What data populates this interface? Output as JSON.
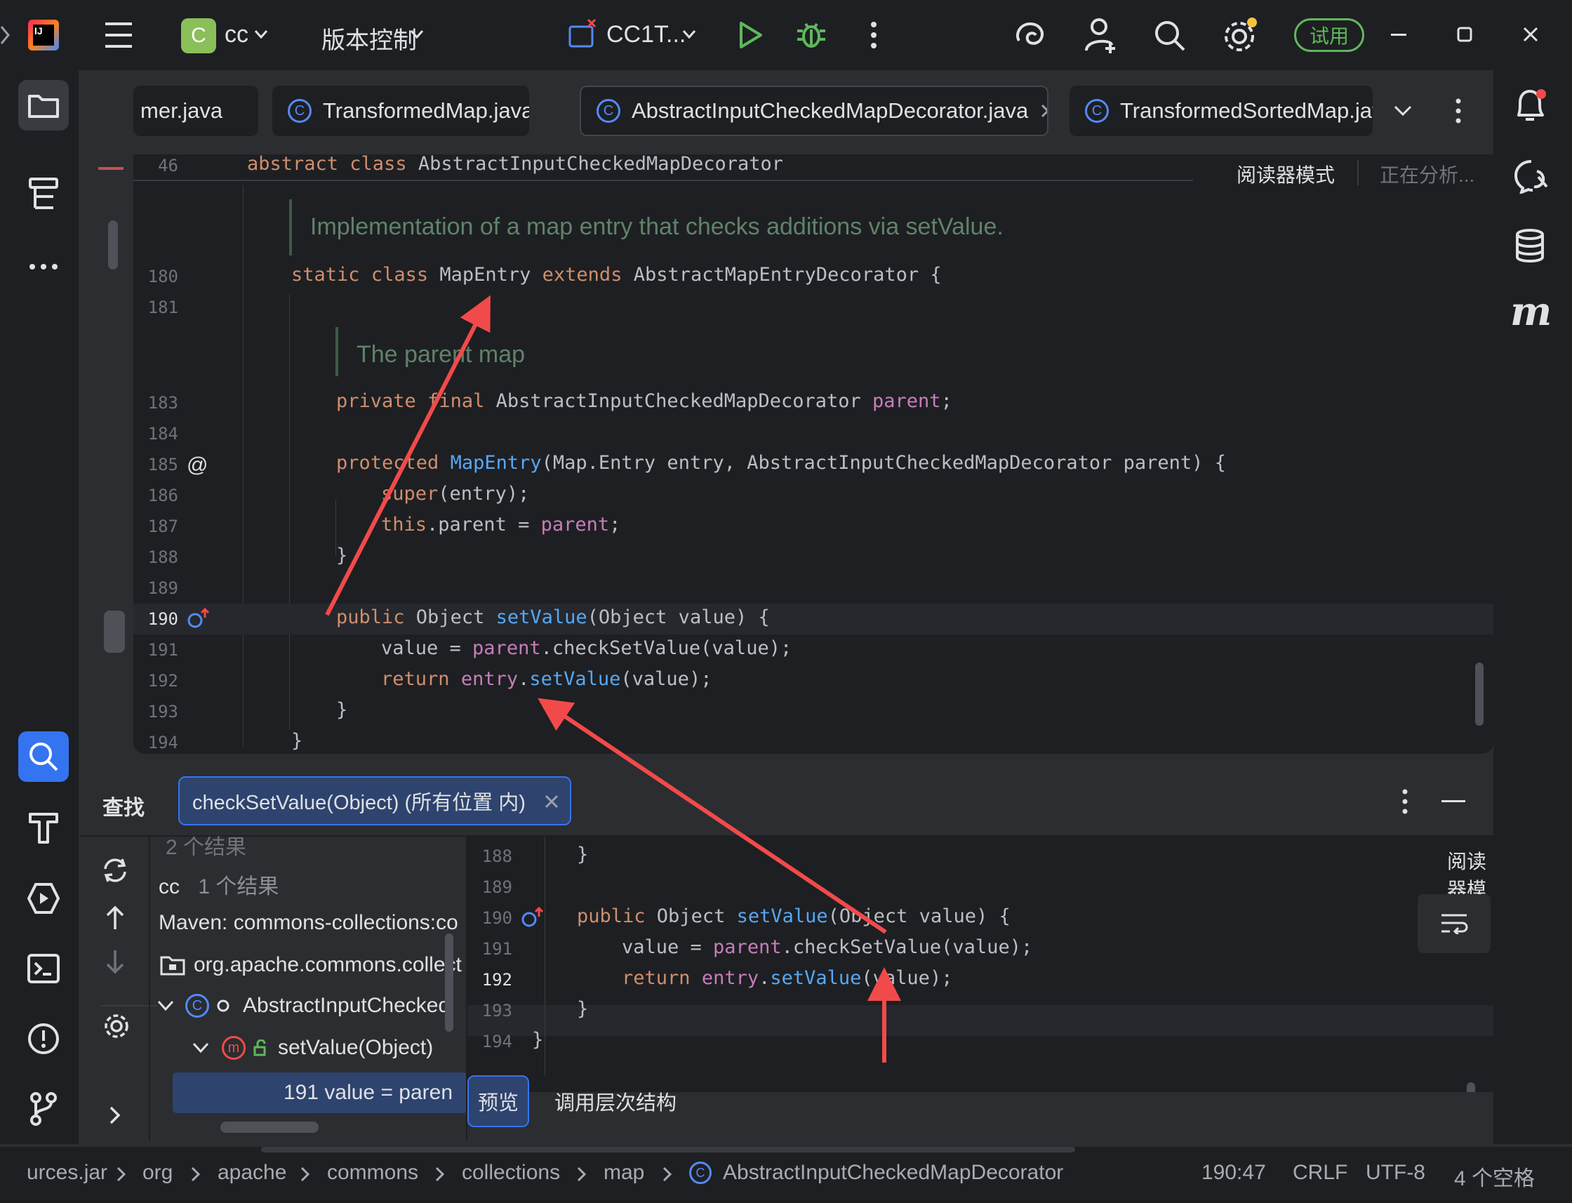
{
  "titlebar": {
    "project_letter": "C",
    "project_name": "cc",
    "vcs_label": "版本控制",
    "run_config": "CC1T...",
    "trial_label": "试用"
  },
  "tabs": [
    {
      "label": "mer.java"
    },
    {
      "label": "TransformedMap.java"
    },
    {
      "label": "AbstractInputCheckedMapDecorator.java",
      "active": true
    },
    {
      "label": "TransformedSortedMap.jav"
    }
  ],
  "editor": {
    "sticky_line_number": "46",
    "sticky_header": "abstract class AbstractInputCheckedMapDecorator",
    "reader_mode": "阅读器模式",
    "analyzing": "正在分析...",
    "doc_comment_1": "Implementation of a map entry that checks additions via setValue.",
    "doc_comment_2": "The parent map",
    "lines": [
      {
        "n": "180",
        "text": "static class MapEntry extends AbstractMapEntryDecorator {"
      },
      {
        "n": "181",
        "text": ""
      },
      {
        "n": "183",
        "text": "private final AbstractInputCheckedMapDecorator parent;"
      },
      {
        "n": "184",
        "text": ""
      },
      {
        "n": "185",
        "text": "protected MapEntry(Map.Entry entry, AbstractInputCheckedMapDecorator parent) {"
      },
      {
        "n": "186",
        "text": "super(entry);"
      },
      {
        "n": "187",
        "text": "this.parent = parent;"
      },
      {
        "n": "188",
        "text": "}"
      },
      {
        "n": "189",
        "text": ""
      },
      {
        "n": "190",
        "text": "public Object setValue(Object value) {"
      },
      {
        "n": "191",
        "text": "value = parent.checkSetValue(value);"
      },
      {
        "n": "192",
        "text": "return entry.setValue(value);"
      },
      {
        "n": "193",
        "text": "}"
      },
      {
        "n": "194",
        "text": "}"
      }
    ]
  },
  "find_panel": {
    "title": "查找",
    "query_tab": "checkSetValue(Object) (所有位置 内)",
    "results_total": "2 个结果",
    "tree": [
      {
        "label": "cc",
        "count": "1 个结果"
      },
      {
        "label": "Maven: commons-collections:co"
      },
      {
        "label": "org.apache.commons.collect"
      },
      {
        "label": "AbstractInputChecked"
      },
      {
        "label": "setValue(Object)"
      },
      {
        "label": "191 value = paren"
      }
    ],
    "preview_reader_mode": "阅读器模式",
    "preview_lines": [
      {
        "n": "188",
        "text": "}"
      },
      {
        "n": "189",
        "text": ""
      },
      {
        "n": "190",
        "text": "public Object setValue(Object value) {"
      },
      {
        "n": "191",
        "text": "value = parent.checkSetValue(value);"
      },
      {
        "n": "192",
        "text": "return entry.setValue(value);"
      },
      {
        "n": "193",
        "text": "}"
      },
      {
        "n": "194",
        "text": "}"
      }
    ],
    "tab_preview": "预览",
    "tab_call_hierarchy": "调用层次结构"
  },
  "statusbar": {
    "breadcrumbs": [
      "urces.jar",
      "org",
      "apache",
      "commons",
      "collections",
      "map",
      "AbstractInputCheckedMapDecorator"
    ],
    "position": "190:47",
    "line_sep": "CRLF",
    "encoding": "UTF-8",
    "indent": "4 个空格"
  },
  "colors": {
    "accent": "#3574f0",
    "annotation_arrow": "#f24a4a",
    "keyword": "#cf8e6d",
    "method": "#56a8f5",
    "field": "#c77dbb",
    "doc": "#5f826b"
  }
}
